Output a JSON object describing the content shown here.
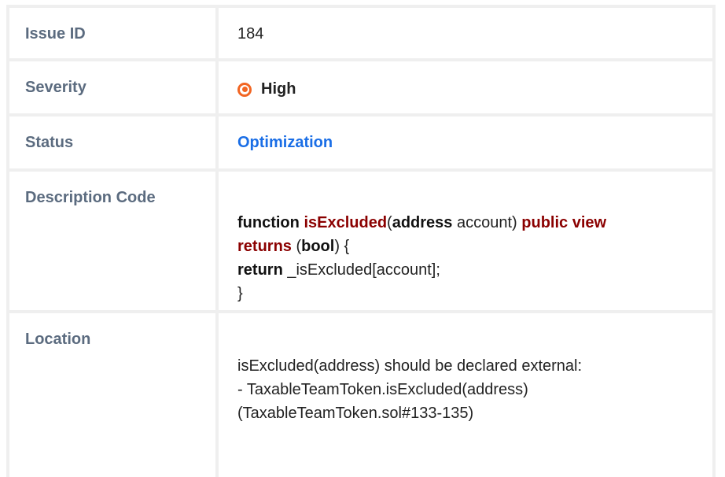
{
  "rows": {
    "issue_id": {
      "label": "Issue ID",
      "value": "184"
    },
    "severity": {
      "label": "Severity",
      "value": "High",
      "color": "#f26522"
    },
    "status": {
      "label": "Status",
      "value": "Optimization",
      "color": "#1a6ee6"
    },
    "description": {
      "label": "Description Code",
      "code": {
        "l1_fn": "function",
        "l1_name": "isExcluded",
        "l1_paren": "(",
        "l1_type": "address",
        "l1_arg": " account) ",
        "l1_mods": "public view",
        "l2_returns": "returns",
        "l2_open": " (",
        "l2_bool": "bool",
        "l2_close": ") {",
        "l3_return": "return",
        "l3_rest": " _isExcluded[account];",
        "l4_close": "}"
      }
    },
    "location": {
      "label": "Location",
      "lines": [
        "isExcluded(address) should be declared external:",
        "- TaxableTeamToken.isExcluded(address)",
        "(TaxableTeamToken.sol#133-135)"
      ]
    }
  }
}
